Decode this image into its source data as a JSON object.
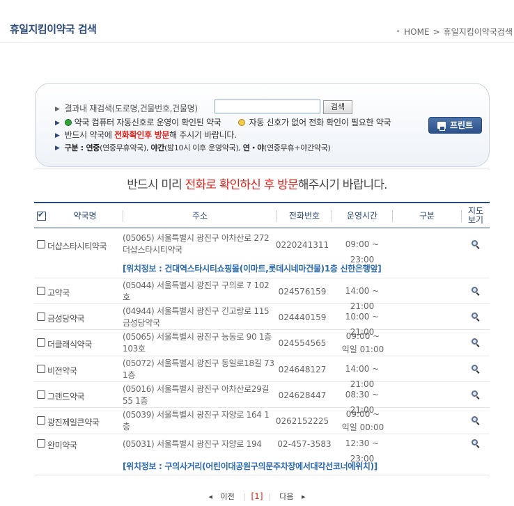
{
  "header": {
    "title": "휴일지킴이약국 검색",
    "breadcrumb": [
      "HOME",
      ">",
      "휴일지킴이약국검색"
    ]
  },
  "search": {
    "label": "결과내 재검색(도로명,건물번호,건물명)",
    "value": "",
    "button_label": "검색",
    "legend_green": "약국 컴퓨터 자동신호로 운영이 확인된 약국",
    "legend_yellow": "자동 신호가 없어 전화 확인이 필요한 약국",
    "visit_note_pre": "반드시 약국에 ",
    "visit_note_red": "전화확인후 방문",
    "visit_note_post": "해 주시기 바랍니다.",
    "type_label": "구분 : ",
    "type_a": "연중",
    "type_a_desc": "(연중무휴약국), ",
    "type_b": "야간",
    "type_b_desc": "(밤10시 이후 운영약국), ",
    "type_c": "연・야",
    "type_c_desc": "(연중무휴+야간약국)",
    "print_label": "프린트"
  },
  "notice": {
    "pre": "반드시 미리 ",
    "red": "전화로 확인하신 후 방문",
    "post": "해주시기 바랍니다."
  },
  "table": {
    "headers": {
      "name": "약국명",
      "address": "주소",
      "phone": "전화번호",
      "hours": "운영시간",
      "type": "구분",
      "map": "지도\n보기"
    },
    "rows": [
      {
        "name": "더샵스타시티약국",
        "address": "(05065) 서울특별시 광진구 아차산로 272 더샵스타시티약국",
        "phone": "0220241311",
        "hours": "09:00 ~ 23:00",
        "type": "",
        "location": "[위치정보 : 건대역스타시티쇼핑몰(이마트,롯데시네마건물)1층 신한은행앞]"
      },
      {
        "name": "고약국",
        "address": "(05044) 서울특별시 광진구 구의로 7 102호",
        "phone": "024576159",
        "hours": "14:00 ~ 21:00",
        "type": ""
      },
      {
        "name": "금성당약국",
        "address": "(04944) 서울특별시 광진구 긴고랑로 115 금성당약국",
        "phone": "024440159",
        "hours": "10:00 ~ 21:00",
        "type": ""
      },
      {
        "name": "더클래식약국",
        "address": "(05065) 서울특별시 광진구 능동로 90 1층 103호",
        "phone": "024554565",
        "hours": "09:00 ~ 익일 01:00",
        "type": ""
      },
      {
        "name": "비전약국",
        "address": "(05072) 서울특별시 광진구 동일로18길 73 1층",
        "phone": "024648127",
        "hours": "14:00 ~ 21:00",
        "type": ""
      },
      {
        "name": "그랜드약국",
        "address": "(05016) 서울특별시 광진구 아차산로29길 55 1층",
        "phone": "024628447",
        "hours": "08:30 ~ 21:00",
        "type": ""
      },
      {
        "name": "광진제일큰약국",
        "address": "(05039) 서울특별시 광진구 자양로 164 1층",
        "phone": "0262152225",
        "hours": "09:00 ~ 익일 00:00",
        "type": ""
      },
      {
        "name": "완미약국",
        "address": "(05031) 서울특별시 광진구 자양로 194",
        "phone": "02-457-3583",
        "hours": "12:30 ~ 23:00",
        "type": "",
        "location": "[위치정보 : 구의사거리(어린이대공원구의문주차장에서대각선코너에위치)]"
      }
    ]
  },
  "pager": {
    "prev": "이전",
    "current": "[1]",
    "next": "다음"
  }
}
